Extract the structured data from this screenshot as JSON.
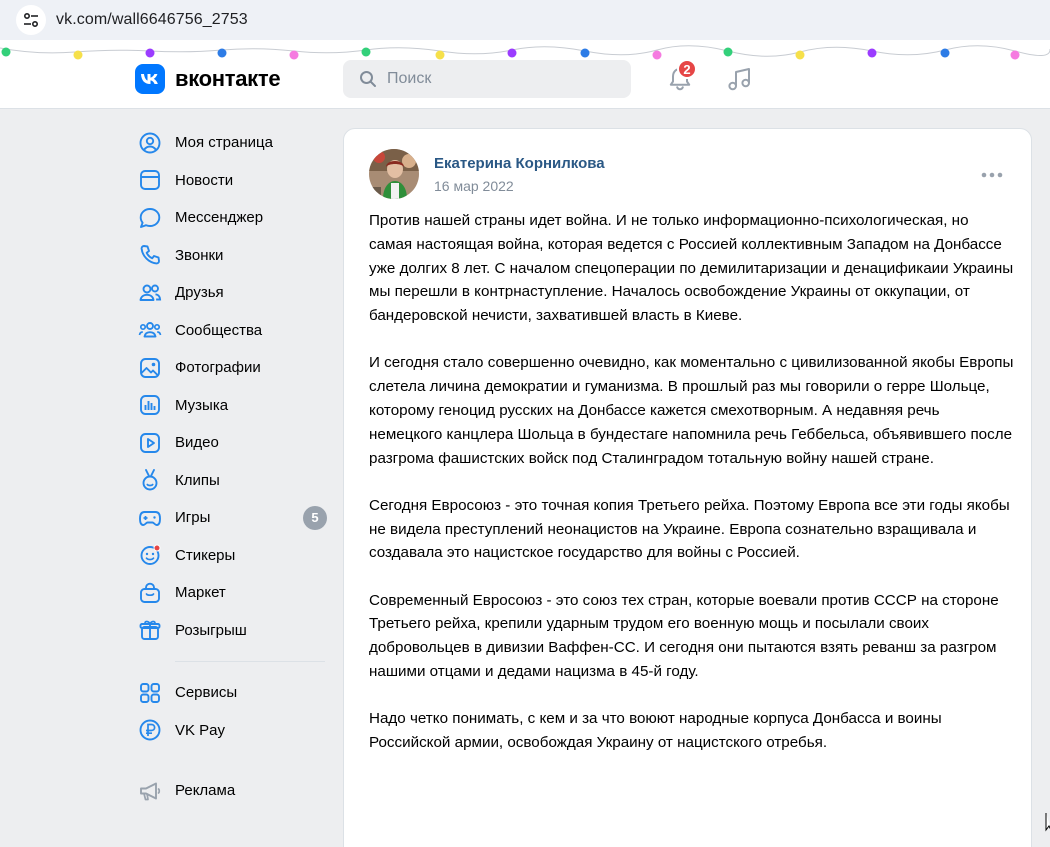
{
  "browser": {
    "url": "vk.com/wall6646756_2753"
  },
  "header": {
    "logo_text": "вконтакте",
    "search_placeholder": "Поиск",
    "notifications_badge": "2"
  },
  "sidebar": {
    "items": [
      {
        "label": "Моя страница",
        "icon": "user-circle-icon"
      },
      {
        "label": "Новости",
        "icon": "news-icon"
      },
      {
        "label": "Мессенджер",
        "icon": "message-icon"
      },
      {
        "label": "Звонки",
        "icon": "phone-icon"
      },
      {
        "label": "Друзья",
        "icon": "friends-icon"
      },
      {
        "label": "Сообщества",
        "icon": "communities-icon"
      },
      {
        "label": "Фотографии",
        "icon": "photo-icon"
      },
      {
        "label": "Музыка",
        "icon": "music-icon"
      },
      {
        "label": "Видео",
        "icon": "video-icon"
      },
      {
        "label": "Клипы",
        "icon": "clips-icon"
      },
      {
        "label": "Игры",
        "icon": "games-icon",
        "counter": "5"
      },
      {
        "label": "Стикеры",
        "icon": "stickers-icon"
      },
      {
        "label": "Маркет",
        "icon": "market-icon"
      },
      {
        "label": "Розыгрыш",
        "icon": "gift-icon"
      }
    ],
    "extra_items": [
      {
        "label": "Сервисы",
        "icon": "services-icon"
      },
      {
        "label": "VK Pay",
        "icon": "vkpay-icon"
      }
    ],
    "bottom_items": [
      {
        "label": "Реклама",
        "icon": "megaphone-icon"
      }
    ]
  },
  "post": {
    "author": "Екатерина Корнилкова",
    "date": "16 мар 2022",
    "paragraphs": [
      "Против нашей страны идет война. И не только информационно-психологическая, но самая настоящая война, которая ведется с Россией коллективным Западом на Донбассе уже долгих 8 лет. С началом спецоперации по демилитаризации и денацификаии Украины мы перешли в контрнаступление. Началось освобождение Украины от оккупации, от бандеровской нечисти, захватившей власть в Киеве.",
      "И сегодня стало совершенно очевидно, как моментально с цивилизованной якобы Европы слетела личина демократии и гуманизма. В прошлый раз мы говорили о герре Шольце, которому геноцид русских на Донбассе кажется смехотворным. А недавняя речь немецкого канцлера Шольца в бундестаге напомнила речь Геббельса, объявившего после разгрома фашистских войск под Сталинградом тотальную войну нашей стране.",
      "Сегодня Евросоюз - это точная копия Третьего рейха. Поэтому Европа все эти годы якобы не видела преступлений неонацистов на Украине. Европа сознательно взращивала и создавала это нацистское государство для войны с Россией.",
      "Современный Евросоюз - это союз тех стран, которые воевали против СССР на стороне Третьего рейха, крепили ударным трудом его военную мощь и посылали своих добровольцев в дивизии Ваффен-СС. И сегодня они пытаются взять реванш за разгром нашими отцами и дедами нацизма в 45-й году.",
      "Надо четко понимать, с кем и за что воюют народные корпуса Донбасса и воины Российской армии, освобождая Украину от нацистского отребья."
    ]
  },
  "colors": {
    "accent": "#0077ff",
    "author_link": "#2a5885",
    "badge_red": "#e64646",
    "icon_blue": "#2688eb",
    "page_bg": "#edeef0"
  }
}
